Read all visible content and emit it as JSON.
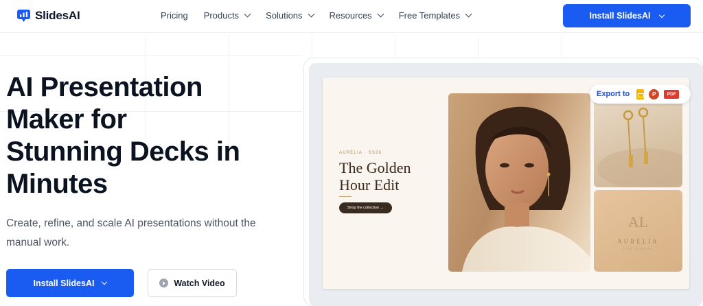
{
  "brand": {
    "name": "SlidesAI",
    "accent": "#1a5cf2"
  },
  "nav": {
    "items": [
      {
        "label": "Pricing",
        "has_dropdown": false
      },
      {
        "label": "Products",
        "has_dropdown": true
      },
      {
        "label": "Solutions",
        "has_dropdown": true
      },
      {
        "label": "Resources",
        "has_dropdown": true
      },
      {
        "label": "Free Templates",
        "has_dropdown": true
      }
    ],
    "cta_label": "Install SlidesAI"
  },
  "hero": {
    "title_lines": [
      "AI Presentation",
      "Maker for",
      "Stunning Decks in",
      "Minutes"
    ],
    "subtitle": "Create, refine, and scale AI presentations without the manual work.",
    "primary_button": "Install SlidesAI",
    "secondary_button": "Watch Video"
  },
  "preview": {
    "export": {
      "label": "Export to",
      "formats": [
        "Google Slides",
        "PowerPoint",
        "PDF"
      ],
      "ppt_glyph": "P",
      "pdf_glyph": "PDF"
    },
    "slide": {
      "kicker": "AURÉLIA · SS26",
      "title_lines": [
        "The Golden",
        "Hour Edit"
      ],
      "cta": "Shop the collection →",
      "logo_mark": "AL",
      "logo_name": "AURELIA",
      "logo_sub": "FINE JEWELRY"
    }
  },
  "icons": {
    "logo": "slidesai-logo-icon",
    "play": "play-icon",
    "chevron": "chevron-down-icon"
  }
}
